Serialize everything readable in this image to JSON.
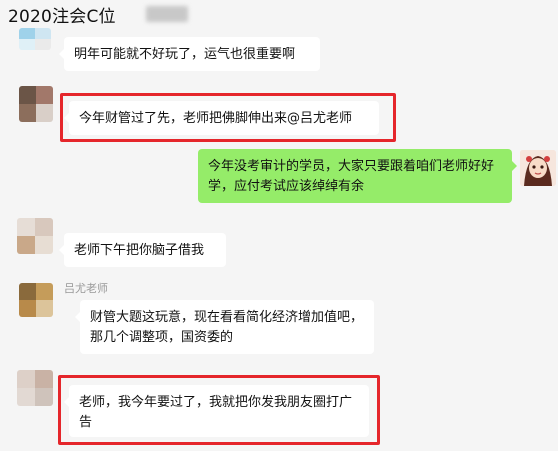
{
  "window": {
    "title": "2020注会C位"
  },
  "messages": [
    {
      "side": "left",
      "sender": "",
      "text": "明年可能就不好玩了，运气也很重要啊",
      "highlighted": false
    },
    {
      "side": "left",
      "sender": "",
      "text": "今年财管过了先，老师把佛脚伸出来@吕尤老师",
      "highlighted": true
    },
    {
      "side": "right",
      "sender": "",
      "text": "今年没考审计的学员，大家只要跟着咱们老师好好学，应付考试应该绰绰有余",
      "highlighted": false
    },
    {
      "side": "left",
      "sender": "",
      "text": "老师下午把你脑子借我",
      "highlighted": false
    },
    {
      "side": "left",
      "sender": "吕尤老师",
      "text": "财管大题这玩意，现在看看简化经济增加值吧，那几个调整项，国资委的",
      "highlighted": false
    },
    {
      "side": "left",
      "sender": "",
      "text": "老师，我今年要过了，我就把你发我朋友圈打广告",
      "highlighted": true
    }
  ],
  "colors": {
    "background": "#f5f5f5",
    "bubble_incoming": "#ffffff",
    "bubble_outgoing": "#95ec69",
    "highlight_box": "#e5262b"
  },
  "icons": [
    "blurred-avatar-icon",
    "anime-avatar-icon"
  ]
}
